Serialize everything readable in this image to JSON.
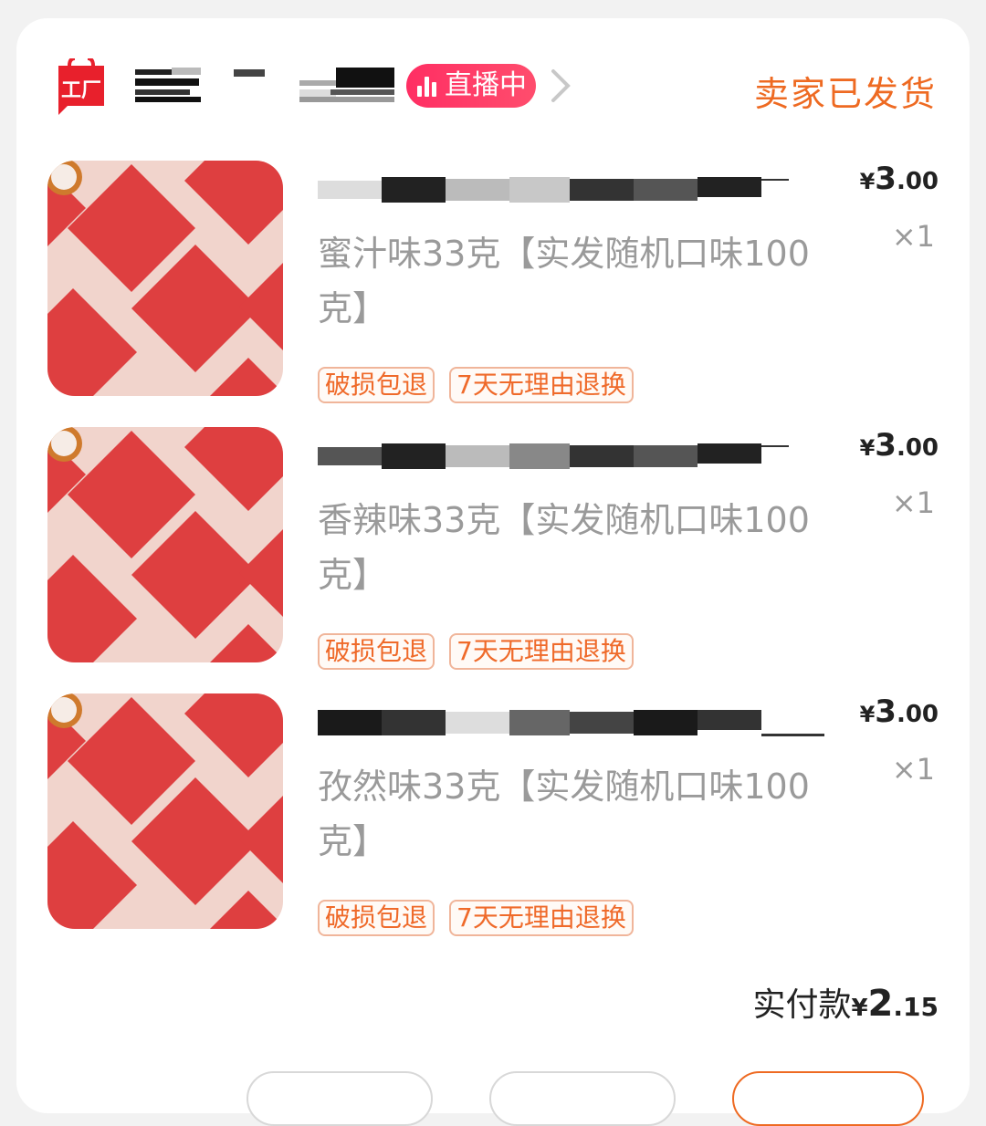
{
  "header": {
    "shop_logo_text": "工厂",
    "live_label": "直播中",
    "order_status": "卖家已发货"
  },
  "items": [
    {
      "spec": "蜜汁味33克【实发随机口味100克】",
      "tags": [
        "破损包退",
        "7天无理由退换"
      ],
      "price": {
        "currency": "¥",
        "integer": "3",
        "decimal": ".00"
      },
      "qty": "×1"
    },
    {
      "spec": "香辣味33克【实发随机口味100克】",
      "tags": [
        "破损包退",
        "7天无理由退换"
      ],
      "price": {
        "currency": "¥",
        "integer": "3",
        "decimal": ".00"
      },
      "qty": "×1"
    },
    {
      "spec": "孜然味33克【实发随机口味100克】",
      "tags": [
        "破损包退",
        "7天无理由退换"
      ],
      "price": {
        "currency": "¥",
        "integer": "3",
        "decimal": ".00"
      },
      "qty": "×1"
    }
  ],
  "total": {
    "label": "实付款",
    "currency": "¥",
    "integer": "2",
    "decimal": ".15"
  },
  "colors": {
    "accent": "#ee6a22",
    "live_badge": "#ff2e63",
    "logo": "#e8202c"
  }
}
